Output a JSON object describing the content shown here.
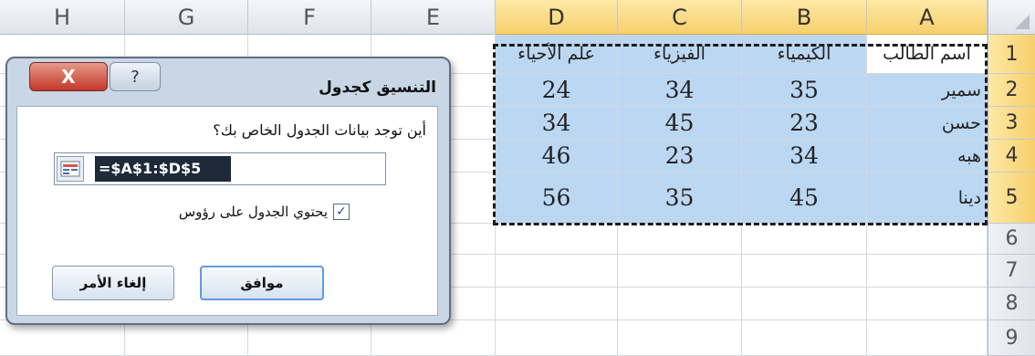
{
  "columns": [
    "H",
    "G",
    "F",
    "E",
    "D",
    "C",
    "B",
    "A"
  ],
  "rows": [
    "1",
    "2",
    "3",
    "4",
    "5",
    "6",
    "7",
    "8",
    "9"
  ],
  "table": {
    "headers": {
      "A": "اسم الطالب",
      "B": "الكيمياء",
      "C": "الفيزياء",
      "D": "علم الأحياء"
    },
    "rows": [
      {
        "A": "سمير",
        "B": "35",
        "C": "34",
        "D": "24"
      },
      {
        "A": "حسن",
        "B": "23",
        "C": "45",
        "D": "34"
      },
      {
        "A": "هبه",
        "B": "34",
        "C": "23",
        "D": "46"
      },
      {
        "A": "دينا",
        "B": "45",
        "C": "35",
        "D": "56"
      }
    ]
  },
  "dialog": {
    "title": "التنسيق كجدول",
    "close_label": "X",
    "help_label": "?",
    "prompt": "أين توجد بيانات الجدول الخاص بك؟",
    "range_value": "=$A$1:$D$5",
    "checkbox_label": "يحتوي الجدول على رؤوس",
    "checkbox_checked": true,
    "ok_label": "موافق",
    "cancel_label": "إلغاء الأمر"
  },
  "colors": {
    "selection_fill": "#bcd7f2",
    "selected_header": "#f7cf6c"
  }
}
